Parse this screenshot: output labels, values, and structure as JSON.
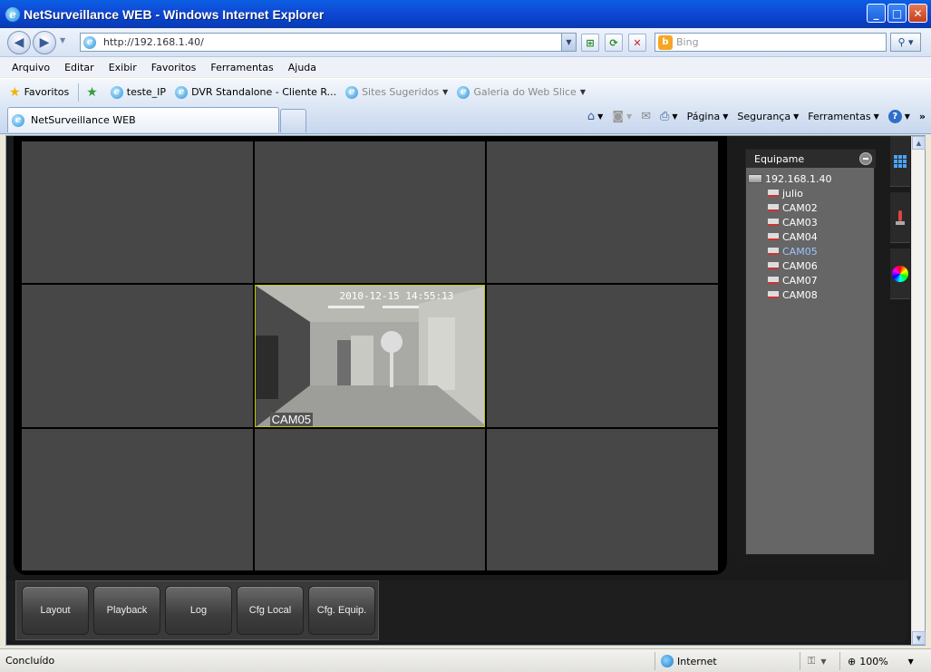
{
  "window": {
    "title": "NetSurveillance WEB - Windows Internet Explorer"
  },
  "address": {
    "url": "http://192.168.1.40/"
  },
  "search": {
    "placeholder": "Bing"
  },
  "menu": [
    "Arquivo",
    "Editar",
    "Exibir",
    "Favoritos",
    "Ferramentas",
    "Ajuda"
  ],
  "favorites": {
    "label": "Favoritos",
    "items": [
      "teste_IP",
      "DVR Standalone - Cliente R...",
      "Sites Sugeridos",
      "Galeria do Web Slice"
    ]
  },
  "tab": {
    "title": "NetSurveillance WEB"
  },
  "commands": {
    "page": "Página",
    "security": "Segurança",
    "tools": "Ferramentas"
  },
  "viewer": {
    "active_cell": {
      "timestamp": "2010-12-15 14:55:13",
      "camera": "CAM05"
    }
  },
  "device_panel": {
    "title": "Equipame",
    "device": "192.168.1.40",
    "channels": [
      "julio",
      "CAM02",
      "CAM03",
      "CAM04",
      "CAM05",
      "CAM06",
      "CAM07",
      "CAM08"
    ],
    "selected": "CAM05"
  },
  "buttons": [
    "Layout",
    "Playback",
    "Log",
    "Cfg Local",
    "Cfg. Equip."
  ],
  "status": {
    "text": "Concluído",
    "zone": "Internet",
    "zoom": "100%"
  }
}
